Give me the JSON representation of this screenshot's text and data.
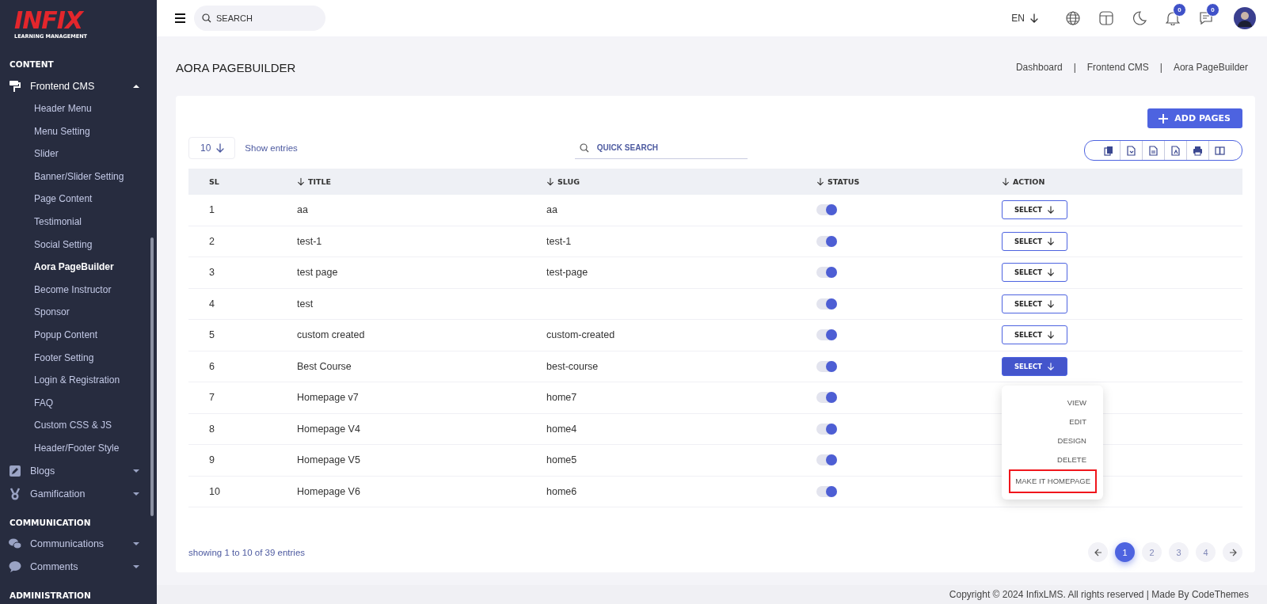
{
  "sidebar": {
    "logo": {
      "brand": "INFIX",
      "tagline": "LEARNING MANAGEMENT"
    },
    "sections": [
      {
        "heading": "CONTENT",
        "items": [
          {
            "label": "Frontend CMS",
            "expanded": true,
            "children": [
              {
                "label": "Header Menu",
                "selected": false
              },
              {
                "label": "Menu Setting",
                "selected": false
              },
              {
                "label": "Slider",
                "selected": false
              },
              {
                "label": "Banner/Slider Setting",
                "selected": false
              },
              {
                "label": "Page Content",
                "selected": false
              },
              {
                "label": "Testimonial",
                "selected": false
              },
              {
                "label": "Social Setting",
                "selected": false
              },
              {
                "label": "Aora PageBuilder",
                "selected": true
              },
              {
                "label": "Become Instructor",
                "selected": false
              },
              {
                "label": "Sponsor",
                "selected": false
              },
              {
                "label": "Popup Content",
                "selected": false
              },
              {
                "label": "Footer Setting",
                "selected": false
              },
              {
                "label": "Login & Registration",
                "selected": false
              },
              {
                "label": "FAQ",
                "selected": false
              },
              {
                "label": "Custom CSS & JS",
                "selected": false
              },
              {
                "label": "Header/Footer Style",
                "selected": false
              }
            ]
          },
          {
            "label": "Blogs",
            "expanded": false
          },
          {
            "label": "Gamification",
            "expanded": false
          }
        ]
      },
      {
        "heading": "COMMUNICATION",
        "items": [
          {
            "label": "Communications",
            "expanded": false
          },
          {
            "label": "Comments",
            "expanded": false
          }
        ]
      },
      {
        "heading": "ADMINISTRATION"
      }
    ]
  },
  "topbar": {
    "search": {
      "placeholder": "SEARCH"
    },
    "language": "EN",
    "notifications": "0",
    "messages": "0"
  },
  "page": {
    "title": "AORA PAGEBUILDER",
    "breadcrumb": {
      "separator": "|",
      "items": [
        "Dashboard",
        "Frontend CMS",
        "Aora PageBuilder"
      ]
    }
  },
  "card": {
    "add_button": "ADD PAGES",
    "page_size": "10",
    "page_size_label": "Show entries",
    "quick_search": {
      "placeholder": "QUICK SEARCH"
    },
    "columns": [
      {
        "label": "SL",
        "sortable": false
      },
      {
        "label": "TITLE",
        "sortable": true
      },
      {
        "label": "SLUG",
        "sortable": true
      },
      {
        "label": "STATUS",
        "sortable": true
      },
      {
        "label": "ACTION",
        "sortable": true
      }
    ],
    "rows": [
      {
        "sl": "1",
        "title": "aa",
        "slug": "aa",
        "active": true,
        "action": {
          "label": "SELECT",
          "open": false
        }
      },
      {
        "sl": "2",
        "title": "test-1",
        "slug": "test-1",
        "active": true,
        "action": {
          "label": "SELECT",
          "open": false
        }
      },
      {
        "sl": "3",
        "title": "test page",
        "slug": "test-page",
        "active": true,
        "action": {
          "label": "SELECT",
          "open": false
        }
      },
      {
        "sl": "4",
        "title": "test",
        "active": true,
        "action": {
          "label": "SELECT",
          "open": false
        }
      },
      {
        "sl": "5",
        "title": "custom created",
        "slug": "custom-created",
        "active": true,
        "action": {
          "label": "SELECT",
          "open": false
        }
      },
      {
        "sl": "6",
        "title": "Best Course",
        "slug": "best-course",
        "active": true,
        "action": {
          "label": "SELECT",
          "open": true,
          "menu": [
            {
              "label": "VIEW",
              "highlighted": false
            },
            {
              "label": "EDIT",
              "highlighted": false
            },
            {
              "label": "DESIGN",
              "highlighted": false
            },
            {
              "label": "DELETE",
              "highlighted": false
            },
            {
              "label": "MAKE IT HOMEPAGE",
              "highlighted": true
            }
          ]
        }
      },
      {
        "sl": "7",
        "title": "Homepage v7",
        "slug": "home7",
        "active": true
      },
      {
        "sl": "8",
        "title": "Homepage V4",
        "slug": "home4",
        "active": true
      },
      {
        "sl": "9",
        "title": "Homepage V5",
        "slug": "home5",
        "active": true
      },
      {
        "sl": "10",
        "title": "Homepage V6",
        "slug": "home6",
        "active": true
      }
    ],
    "summary": "showing 1 to 10 of 39 entries",
    "pages": [
      {
        "label": "1",
        "selected": true
      },
      {
        "label": "2",
        "selected": false
      },
      {
        "label": "3",
        "selected": false
      },
      {
        "label": "4",
        "selected": false
      }
    ]
  },
  "footer": "Copyright © 2024 InfixLMS. All rights reserved | Made By CodeThemes"
}
